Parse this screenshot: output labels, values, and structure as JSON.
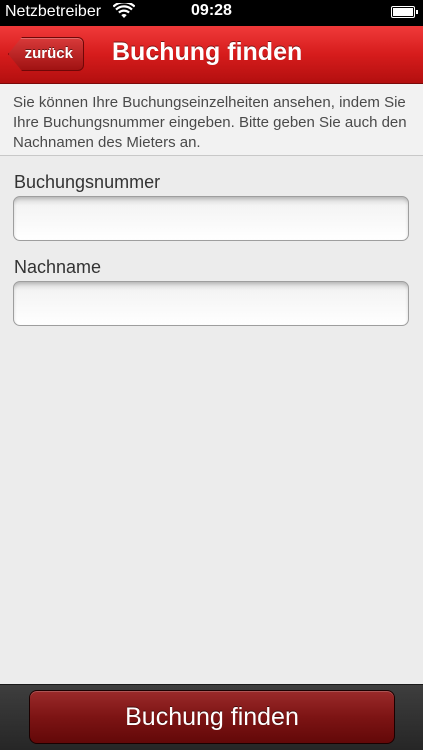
{
  "status_bar": {
    "carrier": "Netzbetreiber",
    "time": "09:28",
    "wifi_icon": "wifi-icon",
    "battery_icon": "battery-icon"
  },
  "nav_bar": {
    "back_label": "zurück",
    "title": "Buchung finden",
    "accent_color": "#d61c1c"
  },
  "info_text": "Sie können Ihre Buchungseinzelheiten ansehen, indem Sie Ihre Buchungsnummer eingeben. Bitte geben Sie auch den Nachnamen des Mieters an.",
  "form": {
    "booking_number": {
      "label": "Buchungsnummer",
      "value": ""
    },
    "last_name": {
      "label": "Nachname",
      "value": ""
    }
  },
  "bottom_bar": {
    "find_button_label": "Buchung finden",
    "button_color": "#7d1414"
  }
}
